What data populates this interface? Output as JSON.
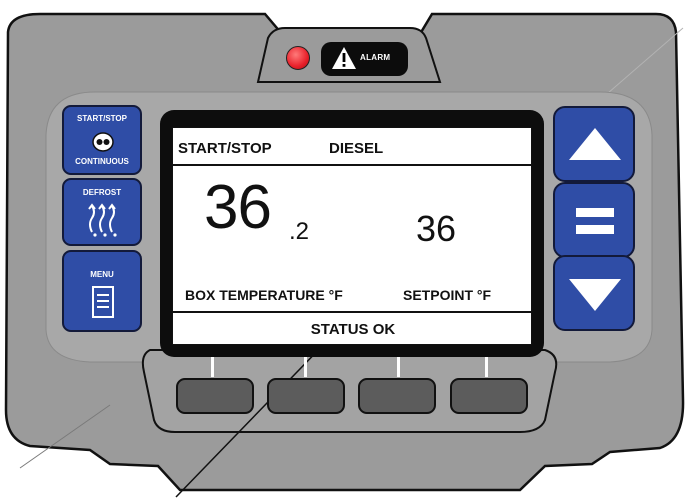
{
  "alarm": {
    "label": "ALARM",
    "icon": "warning-triangle-icon",
    "led_color": "#e8202a"
  },
  "left_buttons": {
    "start_stop": {
      "top_label": "START/STOP",
      "bottom_label": "CONTINUOUS",
      "icon": "start-stop-icon"
    },
    "defrost": {
      "label": "DEFROST",
      "icon": "defrost-icon"
    },
    "menu": {
      "label": "MENU",
      "icon": "menu-icon"
    }
  },
  "right_buttons": {
    "up": {
      "icon": "up-arrow-icon"
    },
    "enter": {
      "icon": "enter-equals-icon"
    },
    "down": {
      "icon": "down-arrow-icon"
    }
  },
  "display": {
    "mode": "START/STOP",
    "fuel": "DIESEL",
    "box_temp_whole": "36",
    "box_temp_decimal": ".2",
    "setpoint_value": "36",
    "box_temp_label": "BOX TEMPERATURE °F",
    "setpoint_label": "SETPOINT °F",
    "status": "STATUS OK"
  },
  "soft_keys": {
    "count": 4
  },
  "colors": {
    "housing": "#9b9b9b",
    "button_blue": "#2f4da6",
    "lcd": "#ffffff",
    "soft_key": "#5c5c5c"
  }
}
